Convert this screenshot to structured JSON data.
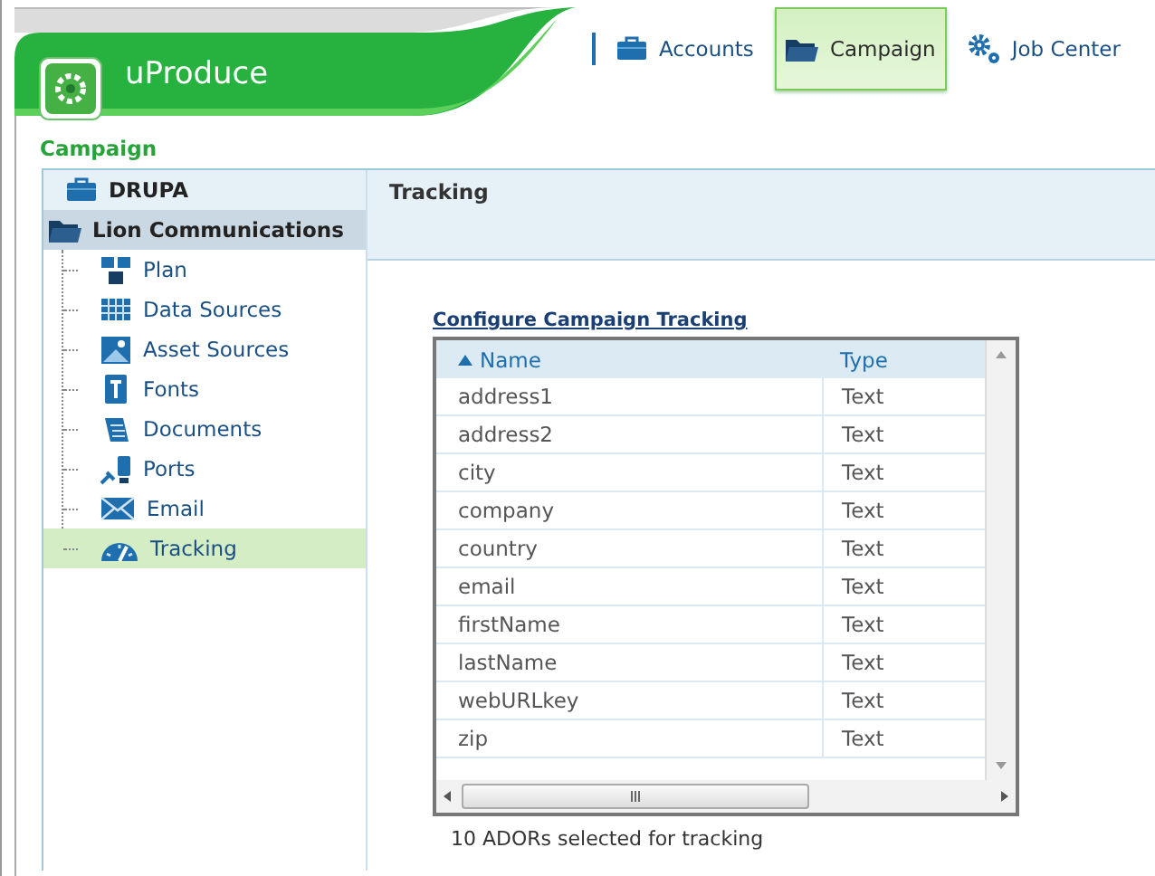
{
  "app": {
    "name": "uProduce"
  },
  "nav": [
    {
      "label": "Accounts",
      "selected": false
    },
    {
      "label": "Campaign",
      "selected": true
    },
    {
      "label": "Job Center",
      "selected": false
    }
  ],
  "breadcrumb": "Campaign",
  "sidebar": {
    "items": [
      {
        "label": "DRUPA",
        "selected": false,
        "expanded": false
      },
      {
        "label": "Lion Communications",
        "selected": false,
        "expanded": true,
        "children": [
          {
            "label": "Plan",
            "selected": false
          },
          {
            "label": "Data Sources",
            "selected": false
          },
          {
            "label": "Asset Sources",
            "selected": false
          },
          {
            "label": "Fonts",
            "selected": false
          },
          {
            "label": "Documents",
            "selected": false
          },
          {
            "label": "Ports",
            "selected": false
          },
          {
            "label": "Email",
            "selected": false
          },
          {
            "label": "Tracking",
            "selected": true
          }
        ]
      }
    ]
  },
  "panel": {
    "title": "Tracking",
    "section_link": "Configure Campaign Tracking",
    "table": {
      "columns": [
        {
          "label": "Name",
          "sorted": true
        },
        {
          "label": "Type",
          "sorted": false
        }
      ],
      "rows": [
        [
          "address1",
          "Text"
        ],
        [
          "address2",
          "Text"
        ],
        [
          "city",
          "Text"
        ],
        [
          "company",
          "Text"
        ],
        [
          "country",
          "Text"
        ],
        [
          "email",
          "Text"
        ],
        [
          "firstName",
          "Text"
        ],
        [
          "lastName",
          "Text"
        ],
        [
          "webURLkey",
          "Text"
        ],
        [
          "zip",
          "Text"
        ]
      ]
    },
    "summary": "10 ADORs selected for tracking"
  }
}
